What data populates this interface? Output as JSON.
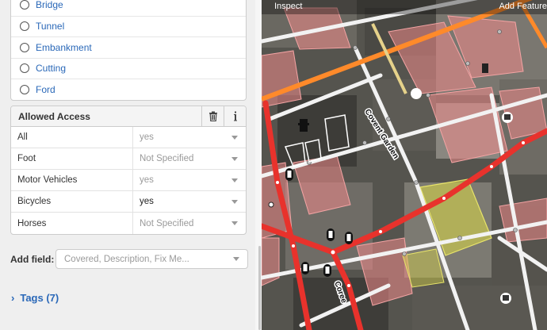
{
  "structure": {
    "options": [
      {
        "label": "Bridge"
      },
      {
        "label": "Tunnel"
      },
      {
        "label": "Embankment"
      },
      {
        "label": "Cutting"
      },
      {
        "label": "Ford"
      }
    ]
  },
  "access": {
    "title": "Allowed Access",
    "delete_icon": "trash-icon",
    "info_icon": "info-icon",
    "rows": [
      {
        "label": "All",
        "value": "yes",
        "set": false
      },
      {
        "label": "Foot",
        "value": "Not Specified",
        "set": false
      },
      {
        "label": "Motor Vehicles",
        "value": "yes",
        "set": false
      },
      {
        "label": "Bicycles",
        "value": "yes",
        "set": true
      },
      {
        "label": "Horses",
        "value": "Not Specified",
        "set": false
      }
    ]
  },
  "add_field": {
    "label": "Add field:",
    "placeholder": "Covered, Description, Fix Me..."
  },
  "tags": {
    "label": "Tags (7)"
  },
  "map": {
    "top_left": "Inspect",
    "top_right": "Add Feature",
    "street_labels": [
      "Covent Garden",
      "Coree"
    ]
  },
  "colors": {
    "link_blue": "#2a68b8",
    "selected_road": "#e8322c",
    "secondary_road": "#ff8a2a",
    "building_fill": "#f08a8a",
    "selected_area": "#d6d24a"
  }
}
